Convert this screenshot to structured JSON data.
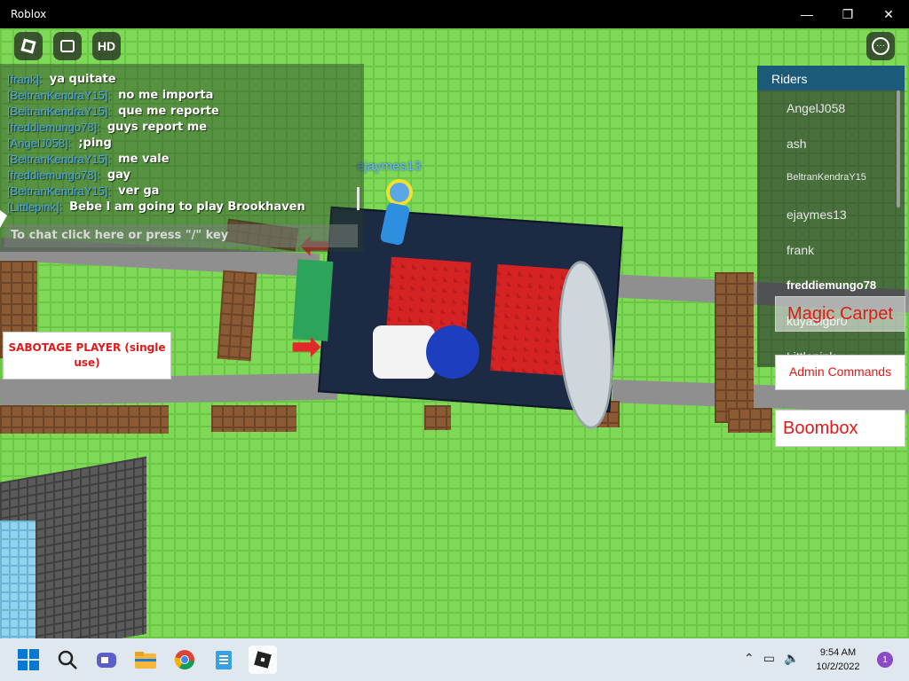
{
  "window": {
    "title": "Roblox",
    "minimize": "—",
    "maximize": "❐",
    "close": "✕"
  },
  "toolbar": {
    "hd_label": "HD",
    "more_label": "···"
  },
  "chat": {
    "messages": [
      {
        "name": "frank",
        "text": "ya quitate"
      },
      {
        "name": "BeltranKendraY15",
        "text": "no me importa"
      },
      {
        "name": "BeltranKendraY15",
        "text": "que me reporte"
      },
      {
        "name": "freddiemungo78",
        "text": "guys report me"
      },
      {
        "name": "AngelJ058",
        "text": ";ping"
      },
      {
        "name": "BeltranKendraY15",
        "text": "me vale"
      },
      {
        "name": "freddiemungo78",
        "text": "gay"
      },
      {
        "name": "BeltranKendraY15",
        "text": "ver ga"
      },
      {
        "name": "Littlepink",
        "text": "Bebe I am going to play Brookhaven"
      }
    ],
    "input_placeholder": "To chat click here or press \"/\" key"
  },
  "game": {
    "player_name": "ejaymes13"
  },
  "riders": {
    "title": "Riders",
    "items": [
      "AngelJ058",
      "ash",
      "BeltranKendraY15",
      "ejaymes13",
      "frank",
      "freddiemungo78",
      "kuyabigbr0",
      "Littlepink"
    ]
  },
  "buttons": {
    "sabotage": "SABOTAGE PLAYER (single use)",
    "magic_carpet": "Magic Carpet",
    "admin_commands": "Admin Commands",
    "boombox": "Boombox"
  },
  "taskbar": {
    "time": "9:54 AM",
    "date": "10/2/2022",
    "notification_count": "1",
    "accent": "#0078d4"
  }
}
